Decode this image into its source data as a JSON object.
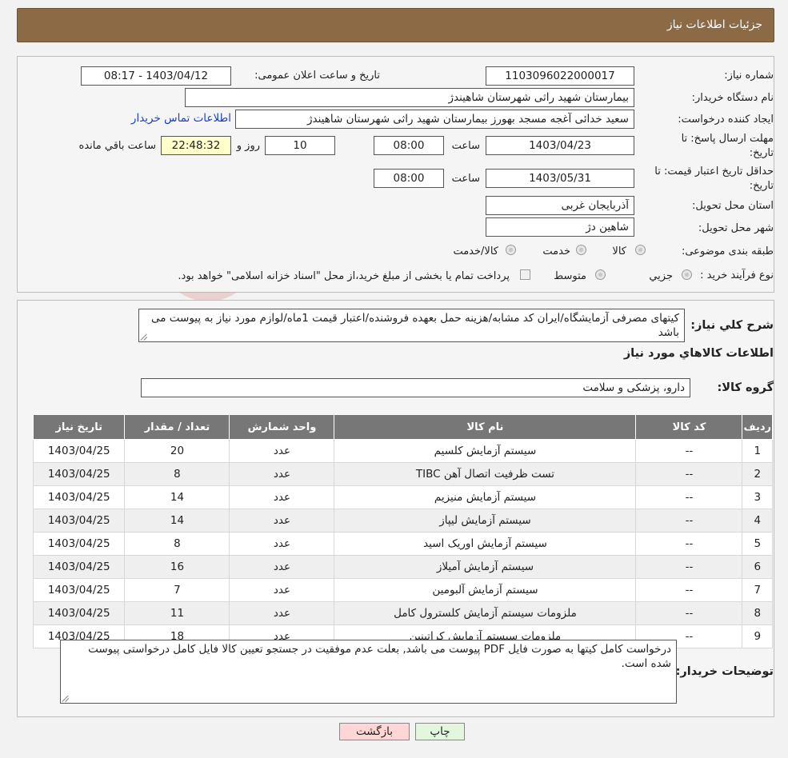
{
  "header": {
    "title": "جزئیات اطلاعات نیاز"
  },
  "form": {
    "need_number_label": "شماره نیاز:",
    "need_number": "1103096022000017",
    "announce_label": "تاریخ و ساعت اعلان عمومی:",
    "announce_value": "1403/04/12 - 08:17",
    "buyer_org_label": "نام دستگاه خریدار:",
    "buyer_org": "بیمارستان شهید راثی شهرستان شاهیندژ",
    "creator_label": "ایجاد کننده درخواست:",
    "creator": "سعید خدائی آغجه مسجد بهورز بیمارستان شهید راثی شهرستان شاهیندژ",
    "contact_link": "اطلاعات تماس خریدار",
    "deadline_label_1": "مهلت ارسال پاسخ: تا",
    "deadline_label_2": "تاریخ:",
    "deadline_date": "1403/04/23",
    "time_label": "ساعت",
    "deadline_time": "08:00",
    "days_value": "10",
    "days_label": "روز و",
    "remaining_time": "22:48:32",
    "remaining_label": "ساعت باقي مانده",
    "validity_label_1": "حداقل تاریخ اعتبار قیمت: تا",
    "validity_label_2": "تاریخ:",
    "validity_date": "1403/05/31",
    "validity_time": "08:00",
    "province_label": "استان محل تحویل:",
    "province": "آذربایجان غربی",
    "city_label": "شهر محل تحویل:",
    "city": "شاهین دژ",
    "category_label": "طبقه بندی موضوعی:",
    "category_options": [
      "کالا",
      "خدمت",
      "کالا/خدمت"
    ],
    "process_label": "نوع فرآیند خرید :",
    "process_options": [
      "جزیي",
      "متوسط"
    ],
    "payment_note": "پرداخت تمام یا بخشی از مبلغ خرید،از محل \"اسناد خزانه اسلامی\" خواهد بود."
  },
  "description": {
    "label": "شرح كلي نياز:",
    "text": "کیتهای مصرفی آزمایشگاه/ایران کد مشابه/هزینه حمل بعهده فروشنده/اعتبار قیمت 1ماه/لوازم مورد نیاز به پیوست می باشد"
  },
  "goods": {
    "section_title": "اطلاعات كالاهاي مورد نياز",
    "group_label": "گروه كالا:",
    "group_value": "دارو، پزشکی و سلامت",
    "columns": [
      "رديف",
      "كد كالا",
      "نام كالا",
      "واحد شمارش",
      "تعداد / مقدار",
      "تاريخ نياز"
    ],
    "rows": [
      [
        "1",
        "--",
        "سیستم آزمایش کلسیم",
        "عدد",
        "20",
        "1403/04/25"
      ],
      [
        "2",
        "--",
        "تست ظرفیت اتصال آهن TIBC",
        "عدد",
        "8",
        "1403/04/25"
      ],
      [
        "3",
        "--",
        "سیستم آزمایش منیزیم",
        "عدد",
        "14",
        "1403/04/25"
      ],
      [
        "4",
        "--",
        "سیستم آزمایش لیپاز",
        "عدد",
        "14",
        "1403/04/25"
      ],
      [
        "5",
        "--",
        "سیستم آزمایش اوریک اسید",
        "عدد",
        "8",
        "1403/04/25"
      ],
      [
        "6",
        "--",
        "سیستم آزمایش آمیلاز",
        "عدد",
        "16",
        "1403/04/25"
      ],
      [
        "7",
        "--",
        "سیستم آزمایش آلبومین",
        "عدد",
        "7",
        "1403/04/25"
      ],
      [
        "8",
        "--",
        "ملزومات سیستم آزمایش کلسترول کامل",
        "عدد",
        "11",
        "1403/04/25"
      ],
      [
        "9",
        "--",
        "ملزومات سیستم آزمایش کراتینین",
        "عدد",
        "18",
        "1403/04/25"
      ]
    ]
  },
  "buyer_notes": {
    "label": "توضیحات خریدار:",
    "text": "درخواست کامل کیتها به صورت فایل PDF پیوست می باشد, بعلت عدم موفقیت در جستجو  تعیین کالا فایل کامل درخواستی پیوست شده است."
  },
  "buttons": {
    "print": "چاپ",
    "back": "بازگشت"
  },
  "colors": {
    "header_bg": "#8b6a45",
    "table_header_bg": "#777777",
    "link": "#1a3fbf",
    "back_button_bg": "#ffd6d6",
    "print_button_bg": "#e3f7df"
  }
}
